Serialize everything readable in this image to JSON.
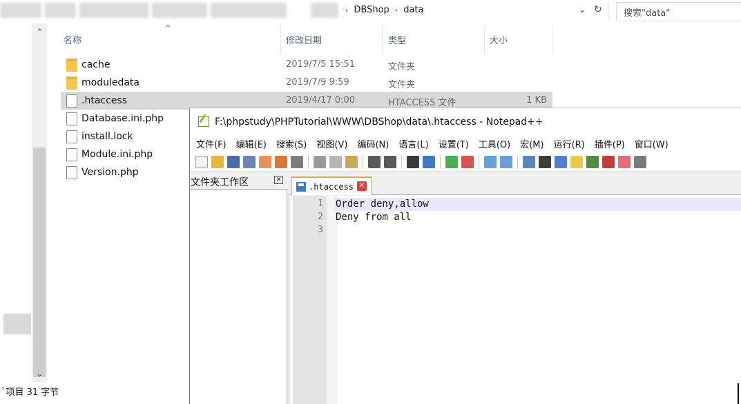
{
  "explorer": {
    "breadcrumb": [
      "DBShop",
      "data"
    ],
    "breadcrumb_sep": "›",
    "dropdown_glyph": "⌄",
    "refresh_glyph": "↻",
    "search_placeholder": "搜索\"data\"",
    "columns": {
      "name": "名称",
      "date": "修改日期",
      "type": "类型",
      "size": "大小"
    },
    "sort_caret": "^",
    "files": [
      {
        "name": "cache",
        "date": "2019/7/5 15:51",
        "type": "文件夹",
        "size": "",
        "kind": "folder"
      },
      {
        "name": "moduledata",
        "date": "2019/7/9 9:59",
        "type": "文件夹",
        "size": "",
        "kind": "folder"
      },
      {
        "name": ".htaccess",
        "date": "2019/4/17 0:00",
        "type": "HTACCESS 文件",
        "size": "1 KB",
        "kind": "file",
        "selected": true
      },
      {
        "name": "Database.ini.php",
        "kind": "file"
      },
      {
        "name": "install.lock",
        "kind": "file"
      },
      {
        "name": "Module.ini.php",
        "kind": "file"
      },
      {
        "name": "Version.php",
        "kind": "file"
      }
    ],
    "status": "`项目  31 字节"
  },
  "notepad": {
    "title": "F:\\phpstudy\\PHPTutorial\\WWW\\DBShop\\data\\.htaccess - Notepad++",
    "menu": [
      "文件(F)",
      "编辑(E)",
      "搜索(S)",
      "视图(V)",
      "编码(N)",
      "语言(L)",
      "设置(T)",
      "工具(O)",
      "宏(M)",
      "运行(R)",
      "插件(P)",
      "窗口(W)"
    ],
    "toolbar_colors": {
      "new": "#f2f2f2",
      "open": "#e8b83a",
      "save": "#4a6ea8",
      "saveall": "#6c86b4",
      "close": "#e9915a",
      "closeall": "#d77a3c",
      "print": "#7d7d7d",
      "cut": "#9a9a9a",
      "copy": "#b7b7b7",
      "paste": "#c9a85e",
      "undo": "#5a5a5a",
      "redo": "#5a5a5a",
      "find": "#3a3a3a",
      "replace": "#3a7ac8",
      "zoomin": "#4caf50",
      "zoomout": "#e05050",
      "sync": "#6aa0d8",
      "wrap": "#5b84c4",
      "allchars": "#3d3d3d",
      "indent": "#4f7fd0",
      "udl": "#eac94d",
      "docmap": "#4d8f3f",
      "funclist": "#c43d3d",
      "folder": "#e76b7a",
      "monitor": "#7a7a7a"
    },
    "folder_panel": {
      "title": "文件夹工作区",
      "close_glyph": "✕"
    },
    "tab": {
      "label": ".htaccess",
      "close_glyph": "✕"
    },
    "lines": [
      {
        "num": "1",
        "text": "Order deny,allow"
      },
      {
        "num": "2",
        "text": "Deny from all"
      },
      {
        "num": "3",
        "text": ""
      }
    ]
  }
}
